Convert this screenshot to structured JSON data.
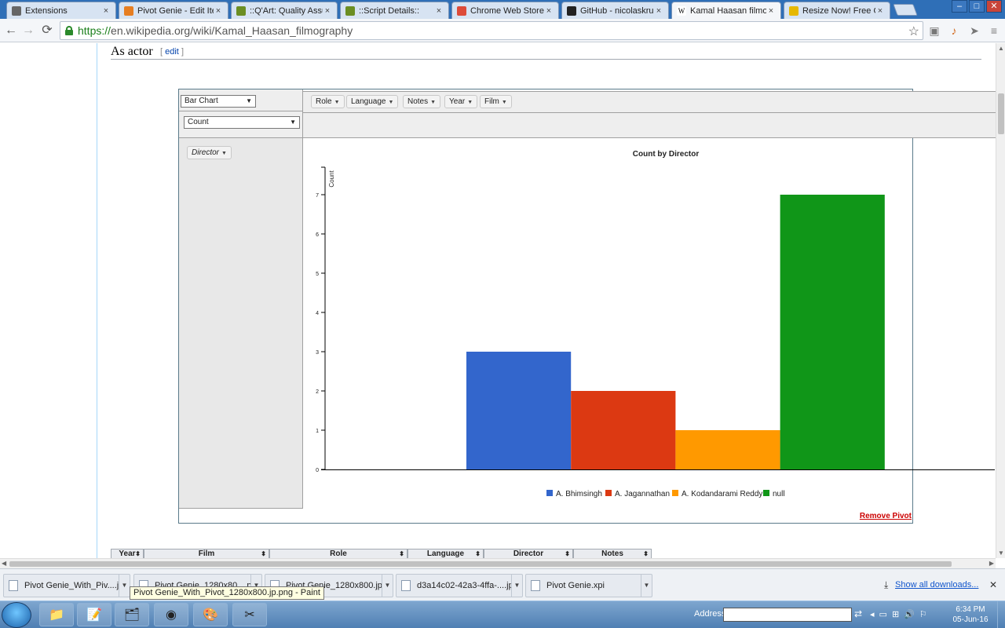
{
  "browser": {
    "tabs": [
      {
        "label": "Extensions",
        "icon": "puzzle-icon",
        "left": 8
      },
      {
        "label": "Pivot Genie - Edit Item",
        "icon": "pivot-genie-icon",
        "left": 151
      },
      {
        "label": "::Q'Art: Quality Assuran",
        "icon": "qart-icon",
        "left": 294
      },
      {
        "label": "::Script Details::",
        "icon": "script-icon",
        "left": 433
      },
      {
        "label": "Chrome Web Store - Y",
        "icon": "webstore-icon",
        "left": 575
      },
      {
        "label": "GitHub - nicolaskrucht",
        "icon": "github-icon",
        "left": 715
      },
      {
        "label": "Kamal Haasan filmogr",
        "icon": "wikipedia-icon",
        "left": 855
      },
      {
        "label": "Resize Now! Free Onlin",
        "icon": "resize-now-icon",
        "left": 998
      }
    ],
    "url_scheme": "https://",
    "url_rest": "en.wikipedia.org/wiki/Kamal_Haasan_filmography"
  },
  "page": {
    "section_title": "As actor",
    "section_edit_open": "[",
    "section_edit_link": "edit",
    "section_edit_close": "]"
  },
  "pivot": {
    "renderer": "Bar Chart",
    "aggregator": "Count",
    "attributes": [
      "Role",
      "Language",
      "Notes",
      "Year",
      "Film"
    ],
    "rows": [
      "Director"
    ],
    "remove_label": "Remove Pivot"
  },
  "chart_data": {
    "type": "bar",
    "title": "Count by Director",
    "ylabel": "Count",
    "xlabel": "",
    "categories": [
      "A. Bhimsingh",
      "A. Jagannathan",
      "A. Kodandarami Reddy",
      "null"
    ],
    "values": [
      3,
      2,
      1,
      7
    ],
    "colors": [
      "#3366cc",
      "#dc3912",
      "#ff9900",
      "#109618"
    ],
    "ylim": [
      0,
      7.7
    ],
    "yticks": [
      0,
      1,
      2,
      3,
      4,
      5,
      6,
      7
    ],
    "legend": "bottom",
    "grid": false
  },
  "table_header": [
    {
      "label": "Year",
      "w": 42
    },
    {
      "label": "Film",
      "w": 160
    },
    {
      "label": "Role",
      "w": 176
    },
    {
      "label": "Language",
      "w": 97
    },
    {
      "label": "Director",
      "w": 114
    },
    {
      "label": "Notes",
      "w": 100
    }
  ],
  "downloads": {
    "items": [
      {
        "label": "Pivot Genie_With_Piv....jpg",
        "left": 4,
        "w": 162
      },
      {
        "label": "Pivot Genie_1280x80....png",
        "left": 170,
        "w": 164
      },
      {
        "label": "Pivot Genie_1280x800.jpg",
        "left": 337,
        "w": 164
      },
      {
        "label": "d3a14c02-42a3-4ffa-....jpg",
        "left": 504,
        "w": 162
      },
      {
        "label": "Pivot Genie.xpi",
        "left": 669,
        "w": 162
      }
    ],
    "show_all": "Show all downloads...",
    "tooltip": "Pivot Genie_With_Pivot_1280x800.jp.png - Paint"
  },
  "taskbar": {
    "address_label": "Address",
    "time": "6:34 PM",
    "date": "05-Jun-16"
  }
}
